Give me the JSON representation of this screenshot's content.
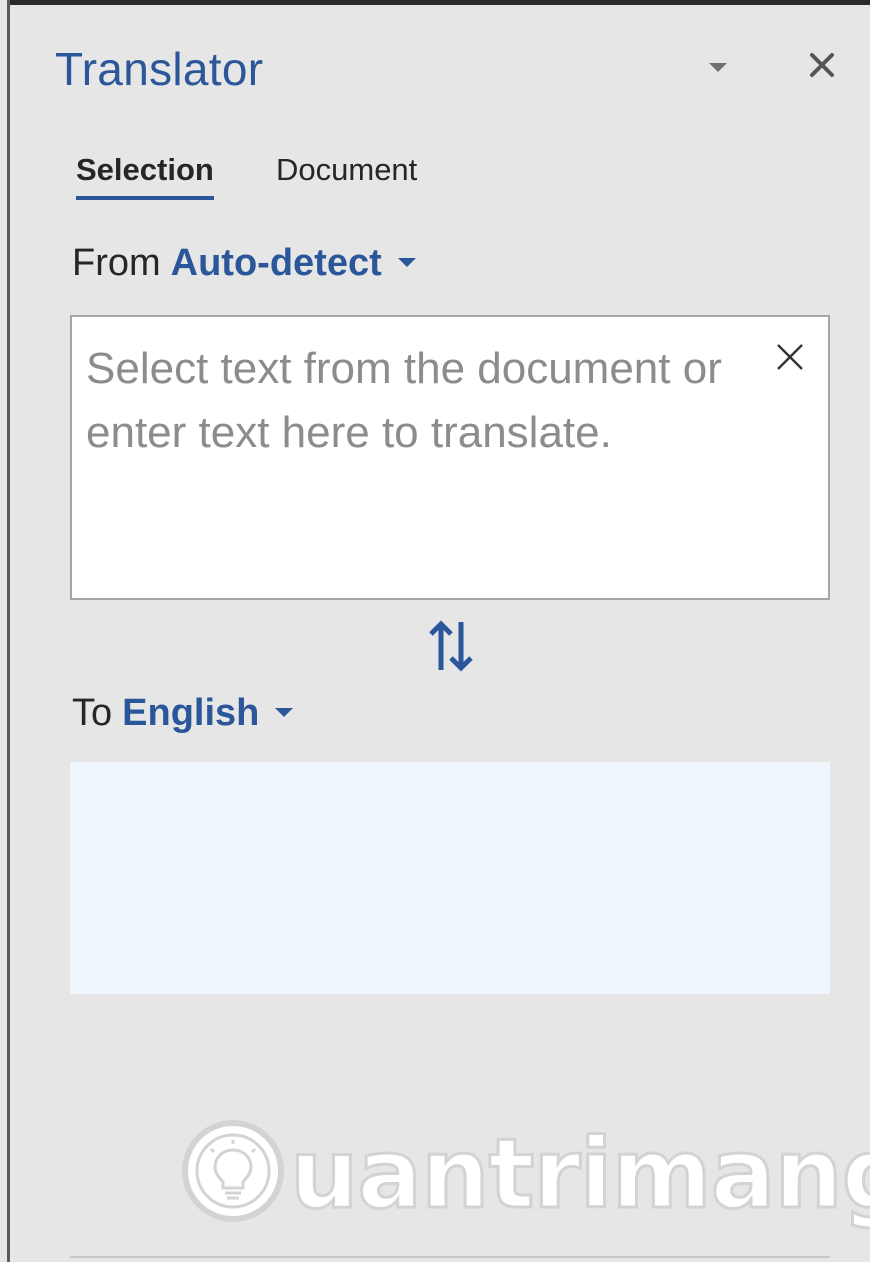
{
  "pane": {
    "title": "Translator",
    "options_icon": "chevron-down-icon",
    "close_icon": "close-icon"
  },
  "tabs": [
    {
      "label": "Selection",
      "selected": true
    },
    {
      "label": "Document",
      "selected": false
    }
  ],
  "from": {
    "label": "From",
    "language": "Auto-detect"
  },
  "source": {
    "value": "",
    "placeholder": "Select text from the document or enter text here to translate.",
    "clear_icon": "close-icon"
  },
  "swap": {
    "icon": "swap-vertical-icon"
  },
  "to": {
    "label": "To",
    "language": "English"
  },
  "target": {
    "value": ""
  },
  "watermark": {
    "text": "uantrimang"
  },
  "colors": {
    "accent": "#2b579a",
    "pane_background": "#e6e6e6",
    "output_background": "#eef5fd",
    "placeholder": "#8c8c8c"
  }
}
